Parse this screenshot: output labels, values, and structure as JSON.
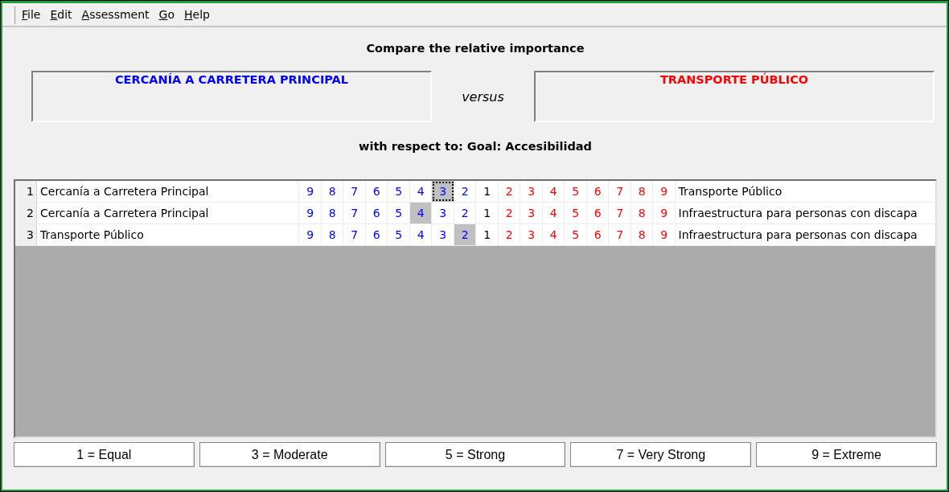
{
  "menu": [
    "File",
    "Edit",
    "Assessment",
    "Go",
    "Help"
  ],
  "heading": "Compare the relative importance",
  "left_element": "CERCANÍA A CARRETERA PRINCIPAL",
  "versus": "versus",
  "right_element": "TRANSPORTE PÚBLICO",
  "respect": "with respect to: Goal: Accesibilidad",
  "rows": [
    {
      "number": "1",
      "left": "Cercanía a Carretera Principal",
      "right": "Transporte Público",
      "focused": true,
      "cells": [
        {
          "label": "9",
          "kind": "left",
          "selected": false
        },
        {
          "label": "8",
          "kind": "left",
          "selected": false
        },
        {
          "label": "7",
          "kind": "left",
          "selected": false
        },
        {
          "label": "6",
          "kind": "left",
          "selected": false
        },
        {
          "label": "5",
          "kind": "left",
          "selected": false
        },
        {
          "label": "4",
          "kind": "left",
          "selected": false
        },
        {
          "label": "3",
          "kind": "left",
          "selected": true
        },
        {
          "label": "2",
          "kind": "left",
          "selected": false
        },
        {
          "label": "1",
          "kind": "equal",
          "selected": false
        },
        {
          "label": "2",
          "kind": "right",
          "selected": false
        },
        {
          "label": "3",
          "kind": "right",
          "selected": false
        },
        {
          "label": "4",
          "kind": "right",
          "selected": false
        },
        {
          "label": "5",
          "kind": "right",
          "selected": false
        },
        {
          "label": "6",
          "kind": "right",
          "selected": false
        },
        {
          "label": "7",
          "kind": "right",
          "selected": false
        },
        {
          "label": "8",
          "kind": "right",
          "selected": false
        },
        {
          "label": "9",
          "kind": "right",
          "selected": false
        }
      ]
    },
    {
      "number": "2",
      "left": "Cercanía a Carretera Principal",
      "right": "Infraestructura para personas con discapa",
      "focused": false,
      "cells": [
        {
          "label": "9",
          "kind": "left",
          "selected": false
        },
        {
          "label": "8",
          "kind": "left",
          "selected": false
        },
        {
          "label": "7",
          "kind": "left",
          "selected": false
        },
        {
          "label": "6",
          "kind": "left",
          "selected": false
        },
        {
          "label": "5",
          "kind": "left",
          "selected": false
        },
        {
          "label": "4",
          "kind": "left",
          "selected": true
        },
        {
          "label": "3",
          "kind": "left",
          "selected": false
        },
        {
          "label": "2",
          "kind": "left",
          "selected": false
        },
        {
          "label": "1",
          "kind": "equal",
          "selected": false
        },
        {
          "label": "2",
          "kind": "right",
          "selected": false
        },
        {
          "label": "3",
          "kind": "right",
          "selected": false
        },
        {
          "label": "4",
          "kind": "right",
          "selected": false
        },
        {
          "label": "5",
          "kind": "right",
          "selected": false
        },
        {
          "label": "6",
          "kind": "right",
          "selected": false
        },
        {
          "label": "7",
          "kind": "right",
          "selected": false
        },
        {
          "label": "8",
          "kind": "right",
          "selected": false
        },
        {
          "label": "9",
          "kind": "right",
          "selected": false
        }
      ]
    },
    {
      "number": "3",
      "left": "Transporte Público",
      "right": "Infraestructura para personas con discapa",
      "focused": false,
      "cells": [
        {
          "label": "9",
          "kind": "left",
          "selected": false
        },
        {
          "label": "8",
          "kind": "left",
          "selected": false
        },
        {
          "label": "7",
          "kind": "left",
          "selected": false
        },
        {
          "label": "6",
          "kind": "left",
          "selected": false
        },
        {
          "label": "5",
          "kind": "left",
          "selected": false
        },
        {
          "label": "4",
          "kind": "left",
          "selected": false
        },
        {
          "label": "3",
          "kind": "left",
          "selected": false
        },
        {
          "label": "2",
          "kind": "left",
          "selected": true
        },
        {
          "label": "1",
          "kind": "equal",
          "selected": false
        },
        {
          "label": "2",
          "kind": "right",
          "selected": false
        },
        {
          "label": "3",
          "kind": "right",
          "selected": false
        },
        {
          "label": "4",
          "kind": "right",
          "selected": false
        },
        {
          "label": "5",
          "kind": "right",
          "selected": false
        },
        {
          "label": "6",
          "kind": "right",
          "selected": false
        },
        {
          "label": "7",
          "kind": "right",
          "selected": false
        },
        {
          "label": "8",
          "kind": "right",
          "selected": false
        },
        {
          "label": "9",
          "kind": "right",
          "selected": false
        }
      ]
    }
  ],
  "legend": [
    "1 = Equal",
    "3 = Moderate",
    "5 = Strong",
    "7 = Very Strong",
    "9 = Extreme"
  ]
}
